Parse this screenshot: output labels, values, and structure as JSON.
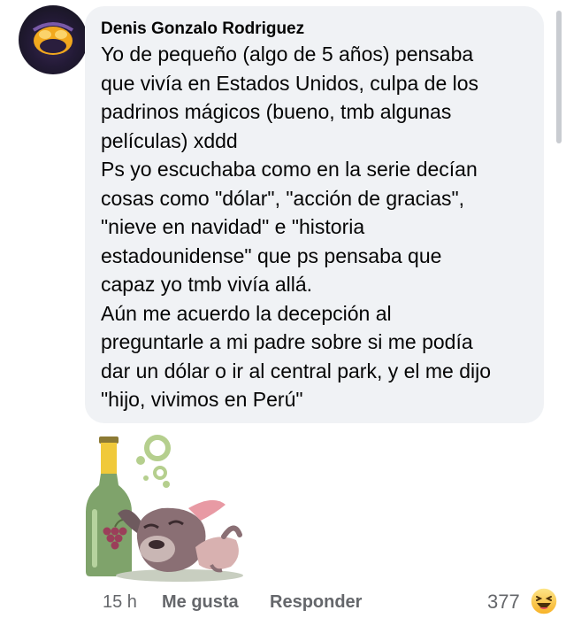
{
  "comment": {
    "author": "Denis Gonzalo Rodriguez",
    "lines": [
      "Yo de pequeño (algo de 5 años) pensaba",
      "que vivía en Estados Unidos, culpa de los",
      "padrinos mágicos (bueno, tmb algunas",
      "películas) xddd",
      "Ps yo escuchaba como en la serie decían",
      "cosas como \"dólar\", \"acción de gracias\",",
      "\"nieve en navidad\" e \"historia",
      "estadounidense\" que ps pensaba que",
      "capaz yo tmb vivía allá.",
      "Aún me acuerdo la decepción al",
      "preguntarle a mi padre sobre si me podía",
      "dar un dólar o ir al central park, y el me dijo",
      "\"hijo, vivimos en Perú\""
    ]
  },
  "footer": {
    "time": "15 h",
    "like_label": "Me gusta",
    "reply_label": "Responder",
    "reaction_count": "377",
    "reaction_icon": "haha-icon"
  },
  "sticker": "drunk-dog-with-bottle-sticker",
  "colors": {
    "bubble_bg": "#f0f2f5",
    "secondary_text": "#65676b",
    "text": "#050505"
  }
}
